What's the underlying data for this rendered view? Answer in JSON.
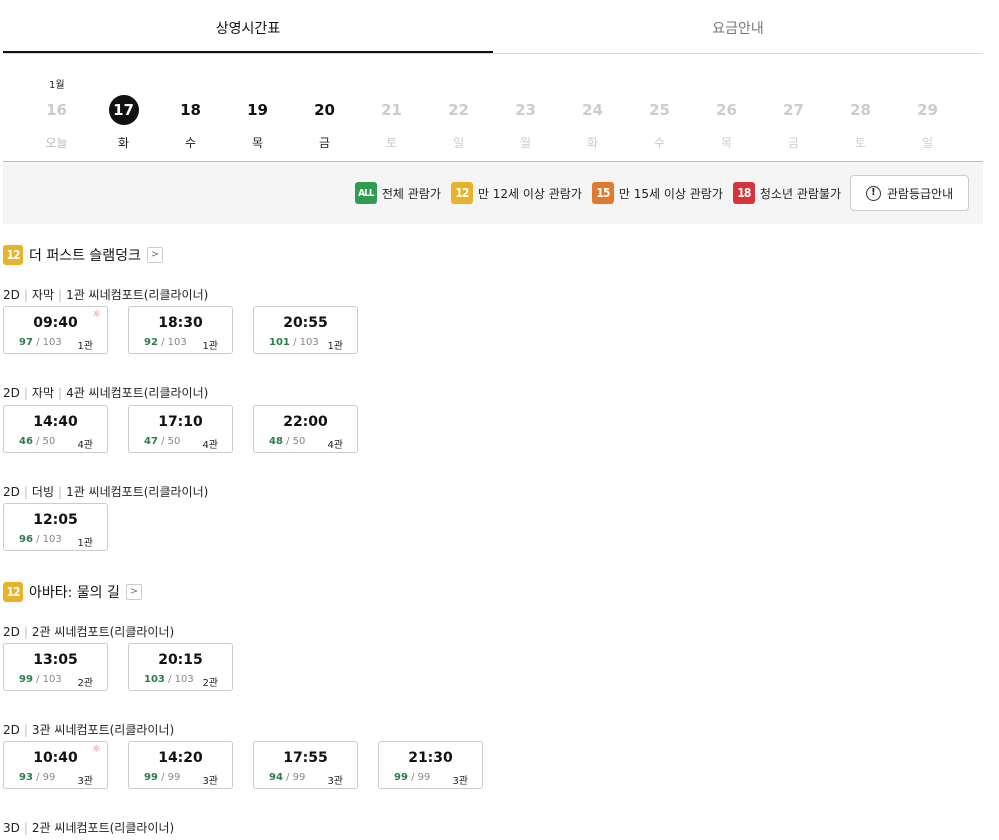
{
  "tabs": [
    {
      "label": "상영시간표"
    },
    {
      "label": "요금안내"
    }
  ],
  "month_label": "1월",
  "dates": [
    {
      "num": "16",
      "day": "오늘"
    },
    {
      "num": "17",
      "day": "화"
    },
    {
      "num": "18",
      "day": "수"
    },
    {
      "num": "19",
      "day": "목"
    },
    {
      "num": "20",
      "day": "금"
    },
    {
      "num": "21",
      "day": "토"
    },
    {
      "num": "22",
      "day": "일"
    },
    {
      "num": "23",
      "day": "월"
    },
    {
      "num": "24",
      "day": "화"
    },
    {
      "num": "25",
      "day": "수"
    },
    {
      "num": "26",
      "day": "목"
    },
    {
      "num": "27",
      "day": "금"
    },
    {
      "num": "28",
      "day": "토"
    },
    {
      "num": "29",
      "day": "일"
    }
  ],
  "legend": [
    {
      "badge": "ALL",
      "label": "전체 관람가",
      "color": "#2f9c52"
    },
    {
      "badge": "12",
      "label": "만 12세 이상 관람가",
      "color": "#e8b32b"
    },
    {
      "badge": "15",
      "label": "만 15세 이상 관람가",
      "color": "#e07a30"
    },
    {
      "badge": "18",
      "label": "청소년 관람불가",
      "color": "#d6343b"
    }
  ],
  "rating_guide_label": "관람등급안내",
  "info_icon_glyph": "!",
  "arrow_glyph": ">",
  "sun_glyph": "☼",
  "movies": [
    {
      "rating": "12",
      "title": "더 퍼스트 슬램덩크",
      "groups": [
        {
          "format": "2D",
          "sub": "자막",
          "screen": "1관 씨네컴포트(리클라이너)",
          "slots": [
            {
              "time": "09:40",
              "avail": "97",
              "total": "/ 103",
              "hall": "1관",
              "morning": true
            },
            {
              "time": "18:30",
              "avail": "92",
              "total": "/ 103",
              "hall": "1관"
            },
            {
              "time": "20:55",
              "avail": "101",
              "total": "/ 103",
              "hall": "1관"
            }
          ]
        },
        {
          "format": "2D",
          "sub": "자막",
          "screen": "4관 씨네컴포트(리클라이너)",
          "slots": [
            {
              "time": "14:40",
              "avail": "46",
              "total": "/ 50",
              "hall": "4관"
            },
            {
              "time": "17:10",
              "avail": "47",
              "total": "/ 50",
              "hall": "4관"
            },
            {
              "time": "22:00",
              "avail": "48",
              "total": "/ 50",
              "hall": "4관"
            }
          ]
        },
        {
          "format": "2D",
          "sub": "더빙",
          "screen": "1관 씨네컴포트(리클라이너)",
          "slots": [
            {
              "time": "12:05",
              "avail": "96",
              "total": "/ 103",
              "hall": "1관"
            }
          ]
        }
      ]
    },
    {
      "rating": "12",
      "title": "아바타: 물의 길",
      "groups": [
        {
          "format": "2D",
          "sub": "",
          "screen": "2관 씨네컴포트(리클라이너)",
          "slots": [
            {
              "time": "13:05",
              "avail": "99",
              "total": "/ 103",
              "hall": "2관"
            },
            {
              "time": "20:15",
              "avail": "103",
              "total": "/ 103",
              "hall": "2관"
            }
          ]
        },
        {
          "format": "2D",
          "sub": "",
          "screen": "3관 씨네컴포트(리클라이너)",
          "slots": [
            {
              "time": "10:40",
              "avail": "93",
              "total": "/ 99",
              "hall": "3관",
              "morning": true
            },
            {
              "time": "14:20",
              "avail": "99",
              "total": "/ 99",
              "hall": "3관"
            },
            {
              "time": "17:55",
              "avail": "94",
              "total": "/ 99",
              "hall": "3관"
            },
            {
              "time": "21:30",
              "avail": "99",
              "total": "/ 99",
              "hall": "3관"
            }
          ]
        },
        {
          "format": "3D",
          "sub": "",
          "screen": "2관 씨네컴포트(리클라이너)",
          "slots": []
        }
      ]
    }
  ]
}
